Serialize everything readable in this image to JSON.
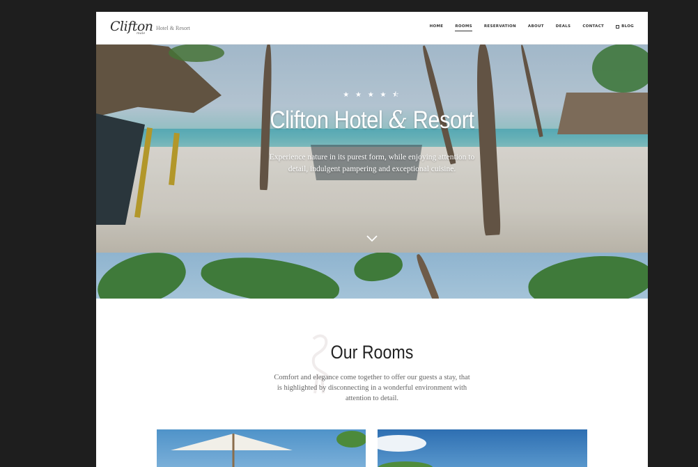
{
  "brand": {
    "logo": "Clifton",
    "logo_sub": "male",
    "tagline": "Hotel & Resort"
  },
  "nav": {
    "items": [
      {
        "label": "HOME",
        "active": false
      },
      {
        "label": "ROOMS",
        "active": true
      },
      {
        "label": "RESERVATION",
        "active": false
      },
      {
        "label": "ABOUT",
        "active": false
      },
      {
        "label": "DEALS",
        "active": false
      },
      {
        "label": "CONTACT",
        "active": false
      },
      {
        "label": "BLOG",
        "active": false,
        "icon": "external-link-icon"
      }
    ]
  },
  "hero": {
    "stars": "★ ★ ★ ★ ⯪",
    "rating": 4.5,
    "title_part1": "Clifton Hotel ",
    "title_amp": "&",
    "title_part2": " Resort",
    "description": "Experience nature in its purest form, while enjoying attention to detail, indulgent pampering and exceptional cuisine.",
    "scroll_icon": "chevron-down-icon"
  },
  "rooms": {
    "title": "Our Rooms",
    "description": "Comfort and elegance come together to offer our guests a stay, that is highlighted by disconnecting in a wonderful environment with attention to detail."
  },
  "colors": {
    "page_background": "#1e1e1e",
    "content_background": "#ffffff",
    "text_dark": "#222222",
    "text_muted": "#666666"
  }
}
